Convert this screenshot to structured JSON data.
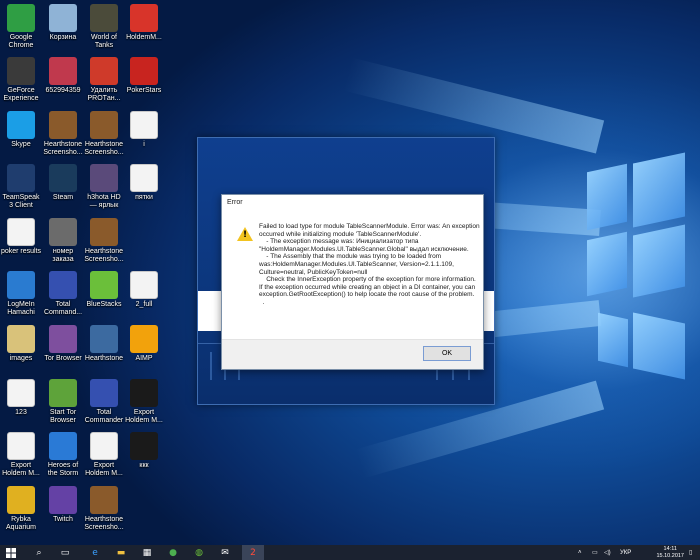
{
  "desktop_icons": [
    {
      "label": "Google Chrome",
      "icon": "chrome-icon",
      "color": "#2f9e44"
    },
    {
      "label": "Корзина",
      "icon": "recycle-bin-icon",
      "color": "#8fb3d6"
    },
    {
      "label": "World of Tanks",
      "icon": "world-of-tanks-icon",
      "color": "#4b4b3a"
    },
    {
      "label": "HoldemM...",
      "icon": "holdem-manager-icon",
      "color": "#d8342a"
    },
    {
      "label": "GeForce Experience",
      "icon": "geforce-icon",
      "color": "#3a3a3a"
    },
    {
      "label": "652994359",
      "icon": "image-file-icon",
      "color": "#c0394d"
    },
    {
      "label": "Удалить PROTан...",
      "icon": "uninstall-icon",
      "color": "#cf3a2a"
    },
    {
      "label": "PokerStars",
      "icon": "pokerstars-icon",
      "color": "#c8241f"
    },
    {
      "label": "Skype",
      "icon": "skype-icon",
      "color": "#1b9ee6"
    },
    {
      "label": "Hearthstone Screensho...",
      "icon": "screenshot-icon",
      "color": "#8a5a2b"
    },
    {
      "label": "Hearthstone Screensho...",
      "icon": "screenshot-icon",
      "color": "#8a5a2b"
    },
    {
      "label": "i",
      "icon": "text-file-icon",
      "color": "#f3f3f3"
    },
    {
      "label": "TeamSpeak 3 Client",
      "icon": "teamspeak-icon",
      "color": "#1f3d6e"
    },
    {
      "label": "Steam",
      "icon": "steam-icon",
      "color": "#1a3b5c"
    },
    {
      "label": "h3hota HD — ярлык",
      "icon": "heroes-icon",
      "color": "#5a4a7a"
    },
    {
      "label": "пятки",
      "icon": "text-file-icon",
      "color": "#f3f3f3"
    },
    {
      "label": "poker results",
      "icon": "text-file-icon",
      "color": "#f3f3f3"
    },
    {
      "label": "номер заказа",
      "icon": "image-file-icon",
      "color": "#6b6b6b"
    },
    {
      "label": "Hearthstone Screensho...",
      "icon": "screenshot-icon",
      "color": "#8a5a2b"
    },
    {
      "label": "",
      "icon": "",
      "color": ""
    },
    {
      "label": "LogMeIn Hamachi",
      "icon": "hamachi-icon",
      "color": "#2a7bd0"
    },
    {
      "label": "Total Command...",
      "icon": "total-commander-icon",
      "color": "#3550b0"
    },
    {
      "label": "BlueStacks",
      "icon": "bluestacks-icon",
      "color": "#6bbf3a"
    },
    {
      "label": "2_full",
      "icon": "text-file-icon",
      "color": "#f3f3f3"
    },
    {
      "label": "images",
      "icon": "folder-icon",
      "color": "#d9c27a"
    },
    {
      "label": "Tor Browser",
      "icon": "tor-browser-icon",
      "color": "#7e4f9e"
    },
    {
      "label": "Hearthstone",
      "icon": "hearthstone-icon",
      "color": "#3c6aa0"
    },
    {
      "label": "AIMP",
      "icon": "aimp-icon",
      "color": "#f2a20c"
    },
    {
      "label": "123",
      "icon": "text-file-icon",
      "color": "#f3f3f3"
    },
    {
      "label": "Start Tor Browser",
      "icon": "tor-globe-icon",
      "color": "#5ea33a"
    },
    {
      "label": "Total Commander",
      "icon": "floppy-icon",
      "color": "#3550b0"
    },
    {
      "label": "Export Holdem M...",
      "icon": "console-icon",
      "color": "#1a1a1a"
    },
    {
      "label": "Export Holdem M...",
      "icon": "text-file-icon",
      "color": "#f3f3f3"
    },
    {
      "label": "Heroes of the Storm",
      "icon": "heroes-storm-icon",
      "color": "#2a7ad6"
    },
    {
      "label": "Export Holdem M...",
      "icon": "text-file-icon",
      "color": "#f3f3f3"
    },
    {
      "label": "ккк",
      "icon": "console-icon",
      "color": "#1a1a1a"
    },
    {
      "label": "Rybka Aquarium",
      "icon": "rybka-icon",
      "color": "#e0b020"
    },
    {
      "label": "Twitch",
      "icon": "twitch-icon",
      "color": "#6441a5"
    },
    {
      "label": "Hearthstone Screensho...",
      "icon": "screenshot-icon",
      "color": "#8a5a2b"
    },
    {
      "label": "",
      "icon": "",
      "color": ""
    }
  ],
  "dialog": {
    "title": "Error",
    "message": "Failed to load type for module TableScannerModule. Error was: An exception occurred while initializing module 'TableScannerModule'.\n    - The exception message was: Инициализатор типа \"HoldemManager.Modules.UI.TableScanner.Global\" выдал исключение.\n    - The Assembly that the module was trying to be loaded from was:HoldemManager.Modules.UI.TableScanner, Version=2.1.1.109, Culture=neutral, PublicKeyToken=null\n    Check the InnerException property of the exception for more information. If the exception occurred while creating an object in a DI container, you can exception.GetRootException() to help locate the root cause of the problem.\n  .",
    "ok_label": "OK"
  },
  "taskbar": {
    "lang": "УКР",
    "time": "14:11",
    "date": "15.10.2017"
  }
}
